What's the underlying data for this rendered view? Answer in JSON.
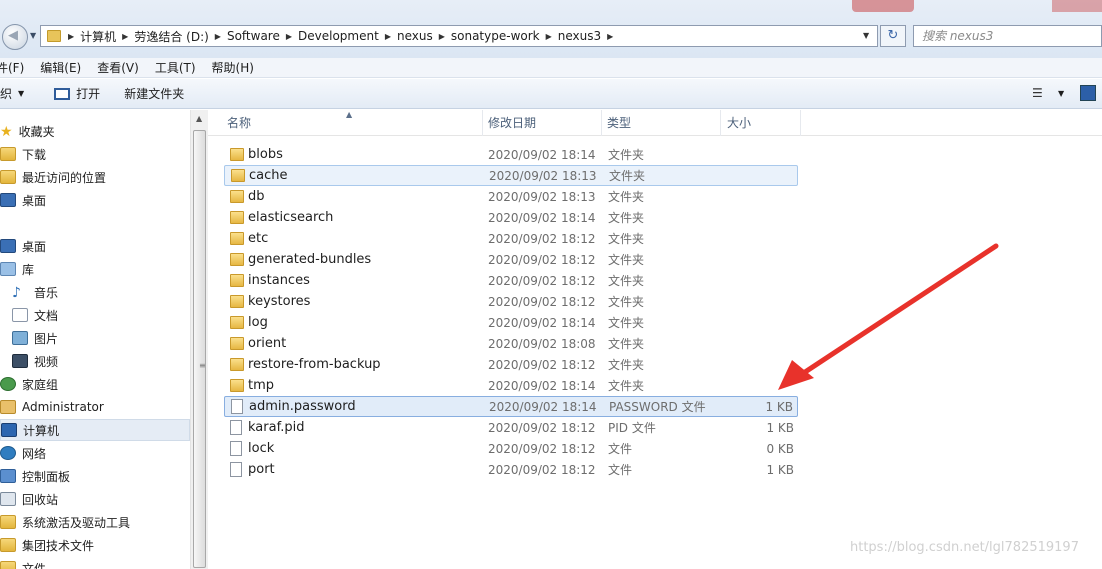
{
  "address": {
    "segments": [
      "计算机",
      "劳逸结合 (D:)",
      "Software",
      "Development",
      "nexus",
      "sonatype-work",
      "nexus3"
    ],
    "search_placeholder": "搜索 nexus3"
  },
  "menu": [
    "件(F)",
    "编辑(E)",
    "查看(V)",
    "工具(T)",
    "帮助(H)"
  ],
  "toolbar": {
    "organize": "织",
    "open": "打开",
    "new_folder": "新建文件夹"
  },
  "nav": [
    {
      "label": "收藏夹",
      "icon": "star-icon"
    },
    {
      "label": "下载",
      "icon": "folder-icon"
    },
    {
      "label": "最近访问的位置",
      "icon": "recent-icon"
    },
    {
      "label": "桌面",
      "icon": "desktop-icon"
    },
    {
      "label": "",
      "icon": ""
    },
    {
      "label": "桌面",
      "icon": "desktop-icon"
    },
    {
      "label": "库",
      "icon": "library-icon"
    },
    {
      "label": "音乐",
      "icon": "music-icon"
    },
    {
      "label": "文档",
      "icon": "document-icon"
    },
    {
      "label": "图片",
      "icon": "picture-icon"
    },
    {
      "label": "视频",
      "icon": "video-icon"
    },
    {
      "label": "家庭组",
      "icon": "homegroup-icon"
    },
    {
      "label": "Administrator",
      "icon": "user-folder-icon"
    },
    {
      "label": "计算机",
      "icon": "computer-icon"
    },
    {
      "label": "网络",
      "icon": "network-icon"
    },
    {
      "label": "控制面板",
      "icon": "control-panel-icon"
    },
    {
      "label": "回收站",
      "icon": "recycle-bin-icon"
    },
    {
      "label": "系统激活及驱动工具",
      "icon": "folder-icon"
    },
    {
      "label": "集团技术文件",
      "icon": "folder-icon"
    },
    {
      "label": "文件",
      "icon": "folder-icon"
    }
  ],
  "columns": {
    "name": "名称",
    "date": "修改日期",
    "type": "类型",
    "size": "大小"
  },
  "files": [
    {
      "name": "blobs",
      "date": "2020/09/02 18:14",
      "type": "文件夹",
      "size": "",
      "kind": "folder"
    },
    {
      "name": "cache",
      "date": "2020/09/02 18:13",
      "type": "文件夹",
      "size": "",
      "kind": "folder"
    },
    {
      "name": "db",
      "date": "2020/09/02 18:13",
      "type": "文件夹",
      "size": "",
      "kind": "folder"
    },
    {
      "name": "elasticsearch",
      "date": "2020/09/02 18:14",
      "type": "文件夹",
      "size": "",
      "kind": "folder"
    },
    {
      "name": "etc",
      "date": "2020/09/02 18:12",
      "type": "文件夹",
      "size": "",
      "kind": "folder"
    },
    {
      "name": "generated-bundles",
      "date": "2020/09/02 18:12",
      "type": "文件夹",
      "size": "",
      "kind": "folder"
    },
    {
      "name": "instances",
      "date": "2020/09/02 18:12",
      "type": "文件夹",
      "size": "",
      "kind": "folder"
    },
    {
      "name": "keystores",
      "date": "2020/09/02 18:12",
      "type": "文件夹",
      "size": "",
      "kind": "folder"
    },
    {
      "name": "log",
      "date": "2020/09/02 18:14",
      "type": "文件夹",
      "size": "",
      "kind": "folder"
    },
    {
      "name": "orient",
      "date": "2020/09/02 18:08",
      "type": "文件夹",
      "size": "",
      "kind": "folder"
    },
    {
      "name": "restore-from-backup",
      "date": "2020/09/02 18:12",
      "type": "文件夹",
      "size": "",
      "kind": "folder"
    },
    {
      "name": "tmp",
      "date": "2020/09/02 18:14",
      "type": "文件夹",
      "size": "",
      "kind": "folder"
    },
    {
      "name": "admin.password",
      "date": "2020/09/02 18:14",
      "type": "PASSWORD 文件",
      "size": "1 KB",
      "kind": "file"
    },
    {
      "name": "karaf.pid",
      "date": "2020/09/02 18:12",
      "type": "PID 文件",
      "size": "1 KB",
      "kind": "file"
    },
    {
      "name": "lock",
      "date": "2020/09/02 18:12",
      "type": "文件",
      "size": "0 KB",
      "kind": "file"
    },
    {
      "name": "port",
      "date": "2020/09/02 18:12",
      "type": "文件",
      "size": "1 KB",
      "kind": "file"
    }
  ],
  "watermark": "https://blog.csdn.net/lgl782519197",
  "colors": {
    "annotation_arrow": "#e8322b",
    "selection": "#cce0f7"
  }
}
